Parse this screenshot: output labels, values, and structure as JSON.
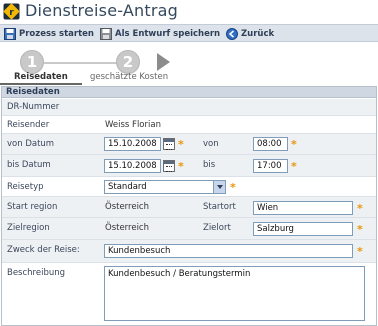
{
  "window": {
    "title": "Dienstreise-Antrag"
  },
  "toolbar": {
    "start_label": "Prozess starten",
    "draft_label": "Als Entwurf speichern",
    "back_label": "Zurück"
  },
  "wizard": {
    "steps": [
      {
        "number": "1",
        "label": "Reisedaten",
        "active": true
      },
      {
        "number": "2",
        "label": "geschätzte Kosten",
        "active": false
      }
    ]
  },
  "form": {
    "section_title": "Reisedaten",
    "dr_nummer": {
      "label": "DR-Nummer",
      "value": ""
    },
    "reisender": {
      "label": "Reisender",
      "value": "Weiss Florian"
    },
    "von_datum": {
      "label": "von Datum",
      "value": "15.10.2008",
      "time_label": "von",
      "time_value": "08:00"
    },
    "bis_datum": {
      "label": "bis Datum",
      "value": "15.10.2008",
      "time_label": "bis",
      "time_value": "17:00"
    },
    "reisetyp": {
      "label": "Reisetyp",
      "value": "Standard"
    },
    "start_region": {
      "label": "Start region",
      "value": "Österreich",
      "ort_label": "Startort",
      "ort_value": "Wien"
    },
    "zielregion": {
      "label": "Zielregion",
      "value": "Österreich",
      "ort_label": "Zielort",
      "ort_value": "Salzburg"
    },
    "zweck": {
      "label": "Zweck der Reise:",
      "value": "Kundenbesuch"
    },
    "beschreibung": {
      "label": "Beschreibung",
      "value": "Kundenbesuch / Beratungstermin"
    },
    "required_marker": "*"
  },
  "colors": {
    "required": "#e8960c",
    "header_bg": "#cfd8e2",
    "toolbar_bg": "#dde3ea",
    "title": "#34495e"
  }
}
